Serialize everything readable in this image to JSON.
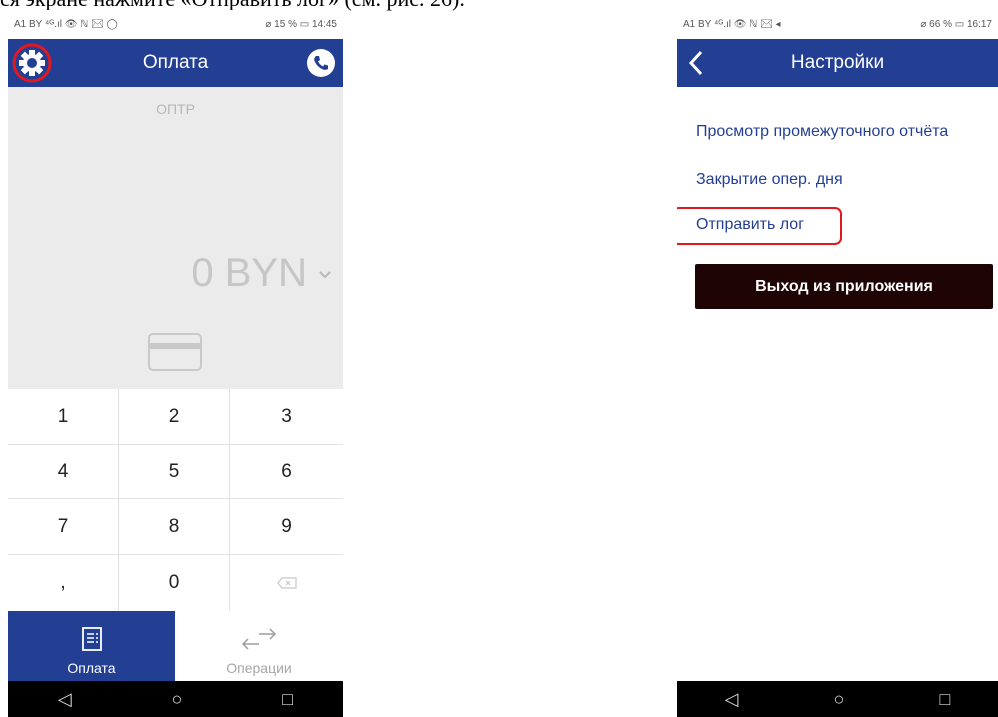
{
  "document_text": "ся экране нажмите «Отправить лог» (см. рис. 26).",
  "left_phone": {
    "status": {
      "left": "A1 BY ⁴ᴳ.ıl 👁 ℕ ✉ ◯",
      "right": "⌀ 15 % ▭ 14:45"
    },
    "header": {
      "title": "Оплата",
      "settings_icon": "gear-icon",
      "phone_icon": "phone-icon"
    },
    "merchant_label": "ОПТР",
    "amount": "0 BYN",
    "amount_dropdown_icon": "chevron-down-icon",
    "card_icon": "card-icon",
    "keypad": [
      "1",
      "2",
      "3",
      "4",
      "5",
      "6",
      "7",
      "8",
      "9",
      ",",
      "0",
      "⌫"
    ],
    "nav": [
      {
        "label": "Оплата",
        "icon": "receipt-icon",
        "active": true
      },
      {
        "label": "Операции",
        "icon": "swap-icon",
        "active": false
      }
    ],
    "accent": "#233f94",
    "highlight_circle_color": "#e0191f"
  },
  "right_phone": {
    "status": {
      "left": "A1 BY ⁴ᴳ.ıl 👁 ℕ ✉ ◂",
      "right": "⌀ 66 % ▭ 16:17"
    },
    "header": {
      "title": "Настройки",
      "back_icon": "back-icon"
    },
    "menu": [
      "Просмотр промежуточного отчёта",
      "Закрытие опер. дня",
      "Отправить лог"
    ],
    "exit_button": "Выход из приложения",
    "exit_button_color": "#1e0405",
    "highlight_box_color": "#e0191f"
  },
  "android_nav": [
    "◁",
    "○",
    "□"
  ]
}
